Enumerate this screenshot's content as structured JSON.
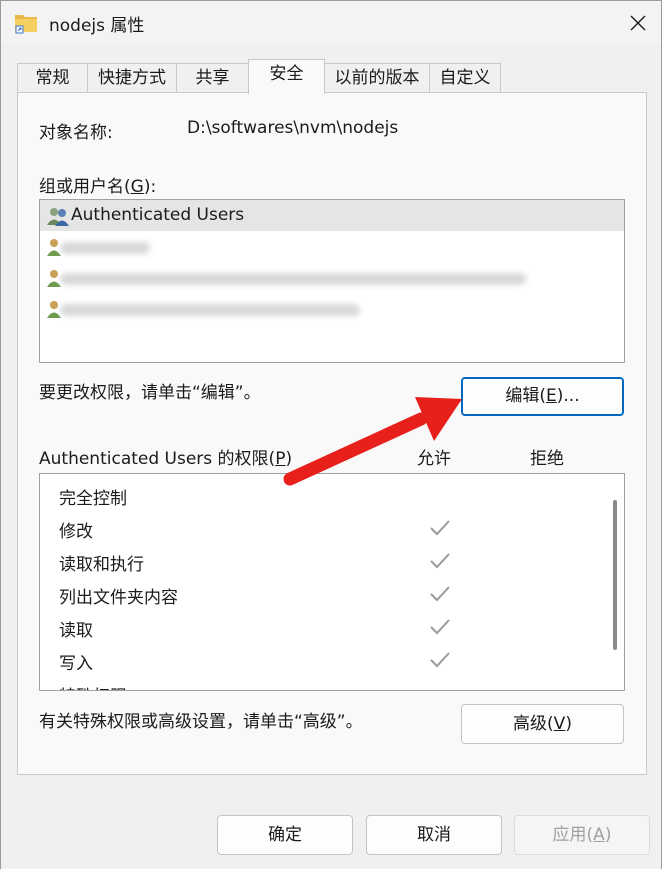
{
  "window": {
    "title": "nodejs 属性",
    "close_label": "close"
  },
  "tabs": [
    {
      "label": "常规"
    },
    {
      "label": "快捷方式"
    },
    {
      "label": "共享"
    },
    {
      "label": "安全"
    },
    {
      "label": "以前的版本"
    },
    {
      "label": "自定义"
    }
  ],
  "security": {
    "object_name_label": "对象名称:",
    "object_name_value": "D:\\softwares\\nvm\\nodejs",
    "groups_label": "组或用户名(G):",
    "users": [
      {
        "name": "Authenticated Users",
        "selected": true
      },
      {
        "name": ""
      },
      {
        "name": ""
      },
      {
        "name": ""
      }
    ],
    "change_hint": "要更改权限，请单击“编辑”。",
    "edit_button": "编辑(E)...",
    "permissions_label": "Authenticated Users 的权限(P)",
    "allow_header": "允许",
    "deny_header": "拒绝",
    "permissions": [
      {
        "name": "完全控制",
        "allow": false
      },
      {
        "name": "修改",
        "allow": true
      },
      {
        "name": "读取和执行",
        "allow": true
      },
      {
        "name": "列出文件夹内容",
        "allow": true
      },
      {
        "name": "读取",
        "allow": true
      },
      {
        "name": "写入",
        "allow": true
      },
      {
        "name": "特殊权限",
        "allow": false
      }
    ],
    "advanced_hint": "有关特殊权限或高级设置，请单击“高级”。",
    "advanced_button": "高级(V)"
  },
  "footer": {
    "ok_button": "确定",
    "cancel_button": "取消",
    "apply_button": "应用(A)"
  },
  "colors": {
    "accent": "#0067c0",
    "arrow": "#e8201c",
    "check": "#9a9a9a"
  }
}
